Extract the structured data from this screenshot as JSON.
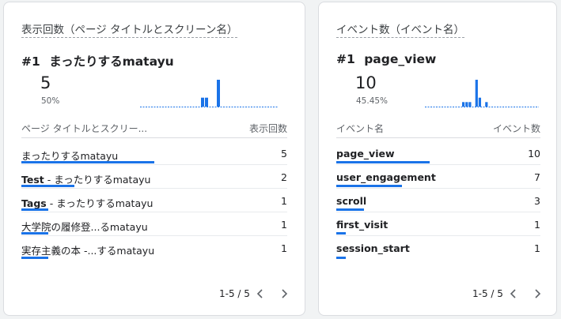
{
  "cards": [
    {
      "title": "表示回数（ページ タイトルとスクリーン名）",
      "top": {
        "rank": "#1",
        "label": "まったりするmatayu",
        "value": "5",
        "percent": "50%"
      },
      "sparkline": [
        0,
        0,
        0,
        0,
        0,
        0,
        0,
        0,
        0,
        0,
        0,
        0,
        0,
        0,
        0,
        0,
        1,
        1,
        0,
        0,
        3,
        0,
        0,
        0,
        0,
        0,
        0,
        0,
        0,
        0,
        0,
        0,
        0,
        0,
        0,
        0
      ],
      "columns": {
        "label": "ページ タイトルとスクリー...",
        "value": "表示回数"
      },
      "rows": [
        {
          "label_bold": "",
          "label": "まったりするmatayu",
          "value": "5",
          "fraction": 1.0
        },
        {
          "label_bold": "Test",
          "label": " - まったりするmatayu",
          "value": "2",
          "fraction": 0.4
        },
        {
          "label_bold": "Tags",
          "label": " - まったりするmatayu",
          "value": "1",
          "fraction": 0.2
        },
        {
          "label_bold": "",
          "label": "大学院の履修登...るmatayu",
          "value": "1",
          "fraction": 0.2
        },
        {
          "label_bold": "",
          "label": "実存主義の本 -...するmatayu",
          "value": "1",
          "fraction": 0.2
        }
      ],
      "pager": {
        "range": "1-5 / 5"
      }
    },
    {
      "title": "イベント数（イベント名）",
      "top": {
        "rank": "#1",
        "label": "page_view",
        "value": "10",
        "percent": "45.45%"
      },
      "sparkline": [
        0,
        0,
        0,
        0,
        0,
        0,
        0,
        0,
        0,
        0,
        0,
        0,
        1,
        1,
        1,
        0,
        6,
        2,
        0,
        1,
        0,
        0,
        0,
        0,
        0,
        0,
        0,
        0,
        0,
        0,
        0,
        0,
        0,
        0,
        0,
        0
      ],
      "columns": {
        "label": "イベント名",
        "value": "イベント数"
      },
      "rows": [
        {
          "label_bold": "page_view",
          "label": "",
          "value": "10",
          "fraction": 1.0
        },
        {
          "label_bold": "user_engagement",
          "label": "",
          "value": "7",
          "fraction": 0.7
        },
        {
          "label_bold": "scroll",
          "label": "",
          "value": "3",
          "fraction": 0.3
        },
        {
          "label_bold": "first_visit",
          "label": "",
          "value": "1",
          "fraction": 0.1
        },
        {
          "label_bold": "session_start",
          "label": "",
          "value": "1",
          "fraction": 0.1
        }
      ],
      "pager": {
        "range": "1-5 / 5"
      }
    }
  ],
  "colors": {
    "accent": "#1a73e8",
    "border": "#dadce0",
    "muted": "#5f6368"
  },
  "icons": {
    "prev": "chevron-left-icon",
    "next": "chevron-right-icon"
  }
}
